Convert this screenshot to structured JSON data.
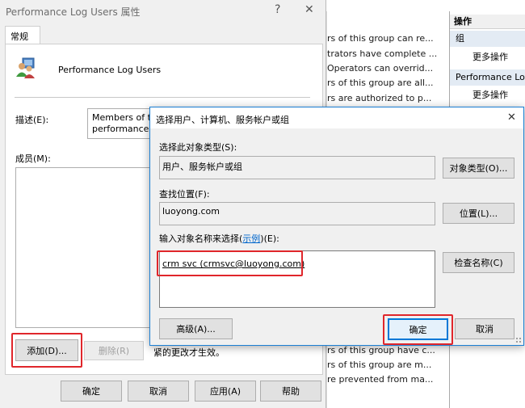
{
  "props_dialog": {
    "title": "Performance Log Users 属性",
    "help_glyph": "?",
    "close_glyph": "✕",
    "tab_general": "常规",
    "group_name": "Performance Log Users",
    "desc_label": "描述(E):",
    "desc_text_line1": "Members of th",
    "desc_text_line2": "performance c",
    "members_label": "成员(M):",
    "add_button": "添加(D)...",
    "remove_button": "删除(R)",
    "note_text": "紧的更改才生效。",
    "ok_button": "确定",
    "cancel_button": "取消",
    "apply_button": "应用(A)",
    "help_button": "帮助"
  },
  "background_list": {
    "descriptions": [
      "rs of this group can re...",
      "trators have complete ...",
      "Operators can overrid...",
      "rs of this group are all...",
      "rs are authorized to p...",
      "rs of this group have c...",
      "rs of this group are m...",
      "re prevented from ma..."
    ]
  },
  "actions_pane": {
    "header": "操作",
    "section1": "组",
    "more1": "更多操作",
    "section2": "Performance Log",
    "more2": "更多操作"
  },
  "select_dialog": {
    "title": "选择用户、计算机、服务帐户或组",
    "close_glyph": "✕",
    "object_type_label": "选择此对象类型(S):",
    "object_type_value": "用户、服务帐户或组",
    "object_type_button": "对象类型(O)...",
    "location_label": "查找位置(F):",
    "location_value": "luoyong.com",
    "location_button": "位置(L)...",
    "names_label_prefix": "输入对象名称来选择(",
    "names_label_link": "示例",
    "names_label_suffix": ")(E):",
    "names_value": "crm svc (crmsvc@luoyong.com)",
    "check_names_button": "检查名称(C)",
    "advanced_button": "高级(A)...",
    "ok_button": "确定",
    "cancel_button": "取消"
  },
  "colors": {
    "highlight_red": "#e0262b",
    "accent_blue": "#1b7fd4",
    "link_blue": "#0066cc"
  }
}
